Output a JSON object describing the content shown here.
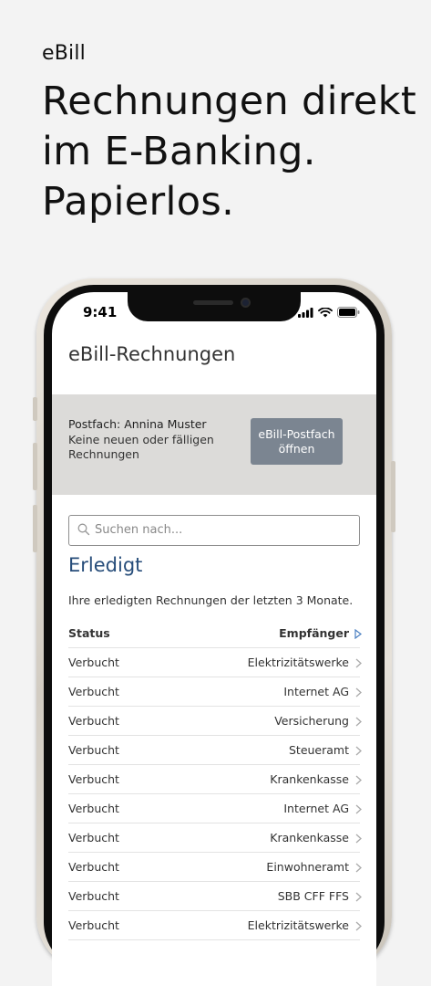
{
  "promo": {
    "label": "eBill",
    "headline": "Rechnungen direkt im E-Banking. Papierlos."
  },
  "status_bar": {
    "time": "9:41"
  },
  "screen": {
    "title": "eBill-Rechnungen",
    "postfach": {
      "name": "Postfach: Annina Muster",
      "status": "Keine neuen oder fälligen Rechnungen",
      "button_label": "eBill-Postfach öffnen"
    },
    "search": {
      "placeholder": "Suchen nach..."
    },
    "section": {
      "title": "Erledigt",
      "description": "Ihre erledigten Rechnungen der letzten 3 Monate."
    },
    "table": {
      "headers": {
        "status": "Status",
        "recipient": "Empfänger"
      },
      "rows": [
        {
          "status": "Verbucht",
          "recipient": "Elektrizitätswerke"
        },
        {
          "status": "Verbucht",
          "recipient": "Internet AG"
        },
        {
          "status": "Verbucht",
          "recipient": "Versicherung"
        },
        {
          "status": "Verbucht",
          "recipient": "Steueramt"
        },
        {
          "status": "Verbucht",
          "recipient": "Krankenkasse"
        },
        {
          "status": "Verbucht",
          "recipient": "Internet AG"
        },
        {
          "status": "Verbucht",
          "recipient": "Krankenkasse"
        },
        {
          "status": "Verbucht",
          "recipient": "Einwohneramt"
        },
        {
          "status": "Verbucht",
          "recipient": "SBB CFF FFS"
        },
        {
          "status": "Verbucht",
          "recipient": "Elektrizitätswerke"
        }
      ]
    }
  },
  "colors": {
    "accent_blue": "#274d7a",
    "button_gray": "#7b8591",
    "panel_gray": "#dcdbd9",
    "sort_indicator": "#4a7fc1"
  }
}
